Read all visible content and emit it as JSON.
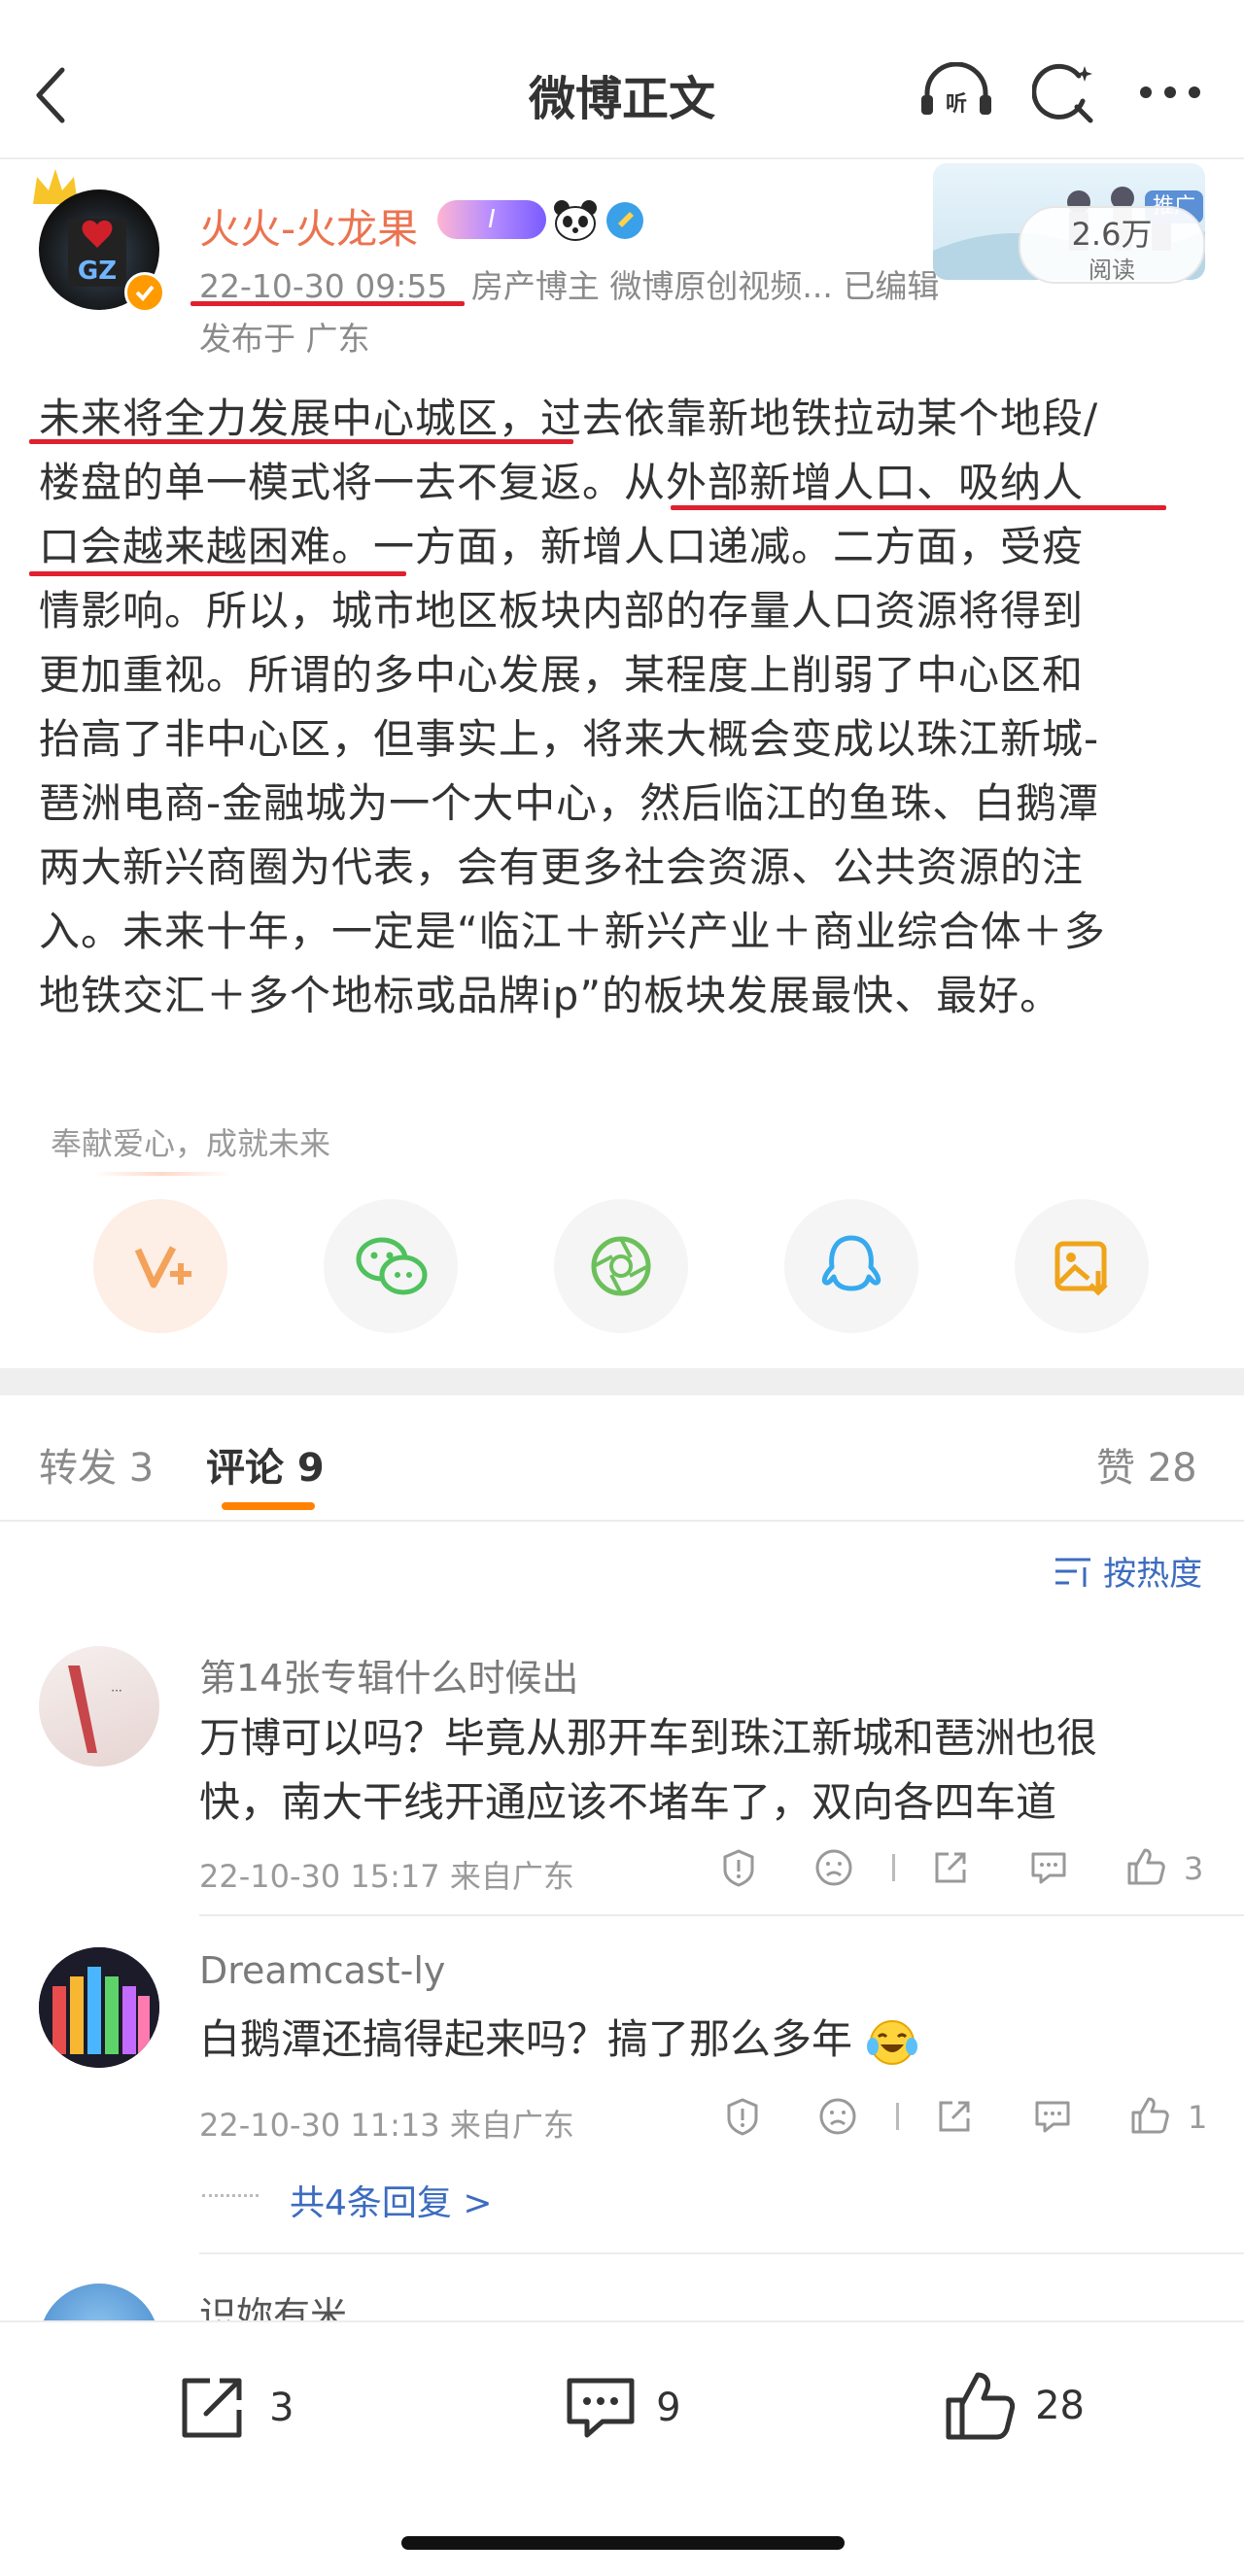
{
  "header": {
    "title": "微博正文"
  },
  "post": {
    "author": "火火-火龙果",
    "badge_label": "I",
    "time": "22-10-30 09:55",
    "meta_rest": "房产博主 微博原创视频... 已编辑",
    "location": "发布于 广东",
    "promo_tag": "推广",
    "reads_count": "2.6万",
    "reads_label": "阅读",
    "lines": [
      "未来将全力发展中心城区，过去依靠新地铁拉动某个地段/",
      "楼盘的单一模式将一去不复返。从外部新增人口、吸纳人",
      "口会越来越困难。一方面，新增人口递减。二方面，受疫",
      "情影响。所以，城市地区板块内部的存量人口资源将得到",
      "更加重视。所谓的多中心发展，某程度上削弱了中心区和",
      "抬高了非中心区，但事实上，将来大概会变成以珠江新城-",
      "琶洲电商-金融城为一个大中心，然后临江的鱼珠、白鹅潭",
      "两大新兴商圈为代表，会有更多社会资源、公共资源的注",
      "入。未来十年，一定是“临江＋新兴产业＋商业综合体＋多",
      "地铁交汇＋多个地标或品牌ip”的板块发展最快、最好。"
    ],
    "charity_text": "奉献爱心，成就未来"
  },
  "tabs": {
    "repost": "转发 3",
    "comment": "评论 9",
    "like": "赞 28",
    "sort": "按热度"
  },
  "comments": [
    {
      "name": "第14张专辑什么时候出",
      "lines": [
        "万博可以吗？毕竟从那开车到珠江新城和琶洲也很",
        "快，南大干线开通应该不堵车了，双向各四车道"
      ],
      "time": "22-10-30 15:17 来自广东",
      "likes": "3"
    },
    {
      "name": "Dreamcast-ly",
      "lines": [
        "白鹅潭还搞得起来吗？搞了那么多年"
      ],
      "time": "22-10-30 11:13 来自广东",
      "likes": "1",
      "replies": "共4条回复 >"
    },
    {
      "name": "识妳有米"
    }
  ],
  "bottom": {
    "repost": "3",
    "comment": "9",
    "like": "28"
  },
  "colors": {
    "accent": "#eb7350",
    "underline": "#e0202e",
    "link": "#3c6cbf",
    "tab_indicator": "#ff8200"
  }
}
